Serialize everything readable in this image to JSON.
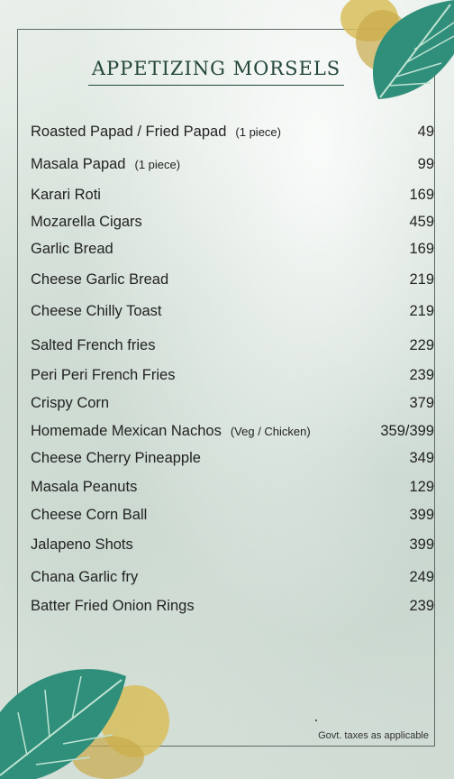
{
  "menu": {
    "title": "APPETIZING MORSELS",
    "items": [
      {
        "name": "Roasted Papad / Fried Papad",
        "note": "(1 piece)",
        "price": "49"
      },
      {
        "name": "Masala Papad",
        "note": "(1 piece)",
        "price": "99"
      },
      {
        "name": "Karari Roti",
        "note": "",
        "price": "169"
      },
      {
        "name": "Mozarella Cigars",
        "note": "",
        "price": "459"
      },
      {
        "name": "Garlic Bread",
        "note": "",
        "price": "169"
      },
      {
        "name": "Cheese Garlic Bread",
        "note": "",
        "price": "219"
      },
      {
        "name": "Cheese Chilly Toast",
        "note": "",
        "price": "219"
      },
      {
        "name": "Salted French fries",
        "note": "",
        "price": "229"
      },
      {
        "name": "Peri Peri French Fries",
        "note": "",
        "price": "239"
      },
      {
        "name": "Crispy Corn",
        "note": "",
        "price": "379"
      },
      {
        "name": "Homemade Mexican Nachos",
        "note": "(Veg / Chicken)",
        "price": "359/399"
      },
      {
        "name": "Cheese Cherry Pineapple",
        "note": "",
        "price": "349"
      },
      {
        "name": "Masala Peanuts",
        "note": "",
        "price": "129"
      },
      {
        "name": "Cheese Corn Ball",
        "note": "",
        "price": "399"
      },
      {
        "name": "Jalapeno Shots",
        "note": "",
        "price": "399"
      },
      {
        "name": "Chana Garlic fry",
        "note": "",
        "price": "249"
      },
      {
        "name": "Batter Fried Onion Rings",
        "note": "",
        "price": "239"
      }
    ],
    "footer": "Govt. taxes as applicable"
  },
  "colors": {
    "title": "#23463a",
    "leaf": "#2f8f7a",
    "gold": "#d4b24a"
  },
  "icons": {
    "top_decoration": "monstera-leaf-icon",
    "bottom_decoration": "monstera-leaf-icon"
  }
}
